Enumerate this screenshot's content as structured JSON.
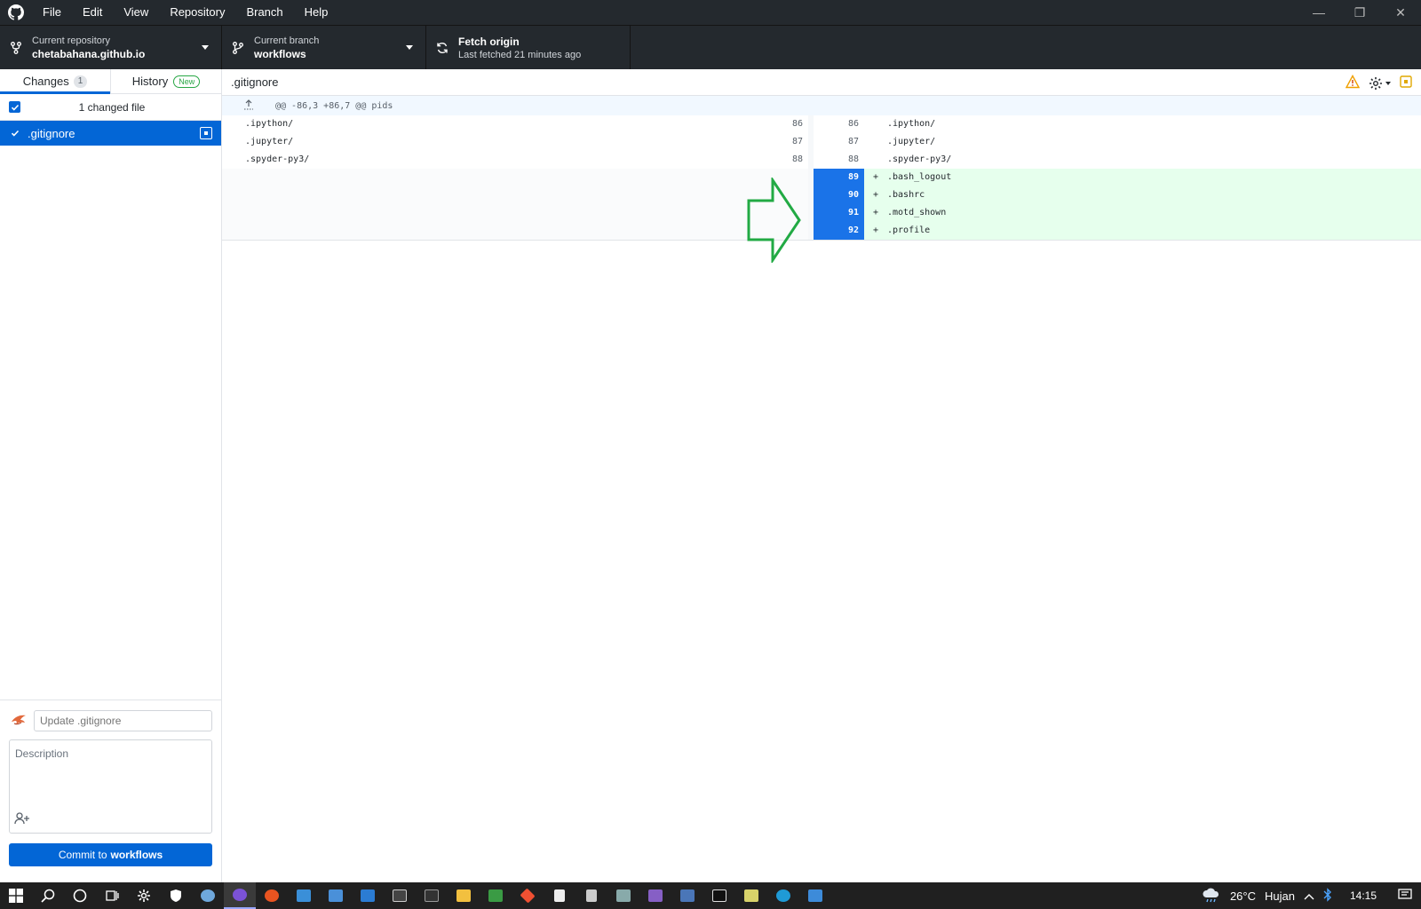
{
  "menu": {
    "items": [
      "File",
      "Edit",
      "View",
      "Repository",
      "Branch",
      "Help"
    ]
  },
  "toolbar": {
    "repo_label": "Current repository",
    "repo_value": "chetabahana.github.io",
    "branch_label": "Current branch",
    "branch_value": "workflows",
    "fetch_label": "Fetch origin",
    "fetch_status": "Last fetched 21 minutes ago"
  },
  "sidebar": {
    "tab_changes": "Changes",
    "changes_count": "1",
    "tab_history": "History",
    "history_badge": "New",
    "changed_files_text": "1 changed file",
    "files": [
      ".gitignore"
    ]
  },
  "commit": {
    "summary_placeholder": "Update .gitignore",
    "description_placeholder": "Description",
    "button_prefix": "Commit to",
    "button_branch": "workflows"
  },
  "diff": {
    "file_name": ".gitignore",
    "hunk_header": "@@ -86,3 +86,7 @@ pids",
    "context_lines": [
      {
        "old": "86",
        "new": "86",
        "text": ".ipython/"
      },
      {
        "old": "87",
        "new": "87",
        "text": ".jupyter/"
      },
      {
        "old": "88",
        "new": "88",
        "text": ".spyder-py3/"
      }
    ],
    "added_lines": [
      {
        "new": "89",
        "text": ".bash_logout"
      },
      {
        "new": "90",
        "text": ".bashrc"
      },
      {
        "new": "91",
        "text": ".motd_shown"
      },
      {
        "new": "92",
        "text": ".profile"
      }
    ],
    "added_sign": "+"
  },
  "taskbar": {
    "temperature": "26°C",
    "weather": "Hujan",
    "time": "14:15"
  },
  "colors": {
    "accent": "#0366d6",
    "added_bg": "#e6ffed",
    "annotation_arrow": "#22aa44",
    "warning": "#f0a000"
  },
  "icons": [
    "github-logo-icon",
    "repo-fork-icon",
    "branch-icon",
    "sync-icon",
    "warning-icon",
    "gear-icon",
    "expand-icon",
    "coauthor-icon"
  ]
}
